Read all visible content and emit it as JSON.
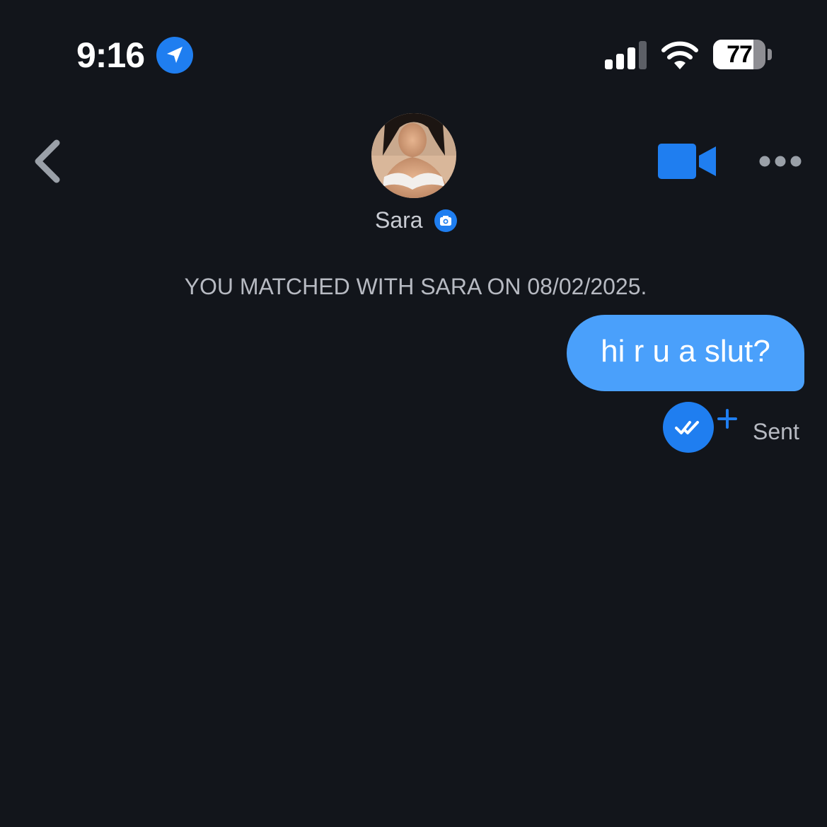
{
  "status_bar": {
    "time": "9:16",
    "battery_level": "77",
    "battery_percent": 77
  },
  "header": {
    "contact_name": "Sara"
  },
  "chat": {
    "match_notice": "YOU MATCHED WITH SARA ON 08/02/2025.",
    "messages": [
      {
        "text": "hi r u a slut?",
        "direction": "outgoing",
        "status": "Sent"
      }
    ]
  },
  "colors": {
    "background": "#12151b",
    "accent": "#1f7ef0",
    "bubble": "#4aa0fb",
    "muted_text": "#b7bac2"
  },
  "icons": {
    "location": "location-arrow-icon",
    "signal": "cellular-signal-icon",
    "wifi": "wifi-icon",
    "battery": "battery-icon",
    "back": "chevron-left-icon",
    "verified": "camera-verified-icon",
    "video": "video-camera-icon",
    "more": "more-horizontal-icon",
    "read_receipt": "double-check-icon",
    "plus": "plus-icon"
  }
}
